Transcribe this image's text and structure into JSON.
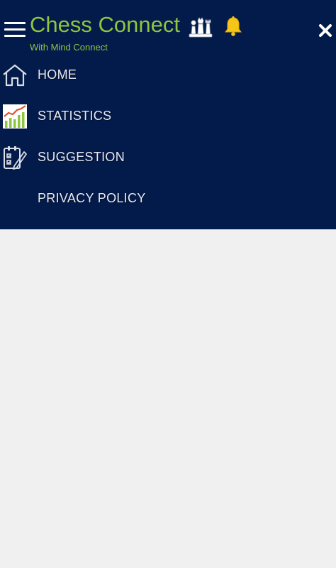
{
  "app": {
    "title": "Chess Connect",
    "subtitle": "With Mind Connect"
  },
  "header": {
    "icons": [
      "menu-icon",
      "chess-pieces-icon",
      "bell-icon",
      "close-icon"
    ]
  },
  "menu": {
    "items": [
      {
        "label": "HOME",
        "icon": "home-icon"
      },
      {
        "label": "STATISTICS",
        "icon": "statistics-chart-icon"
      },
      {
        "label": "SUGGESTION",
        "icon": "suggestion-clipboard-icon"
      },
      {
        "label": "PRIVACY POLICY",
        "icon": ""
      }
    ]
  },
  "colors": {
    "drawer_background": "#031b4b",
    "title_green": "#8dc63f",
    "page_background": "#f0f0f0",
    "bell_yellow": "#f5c518",
    "menu_text": "#e8eaf2"
  }
}
